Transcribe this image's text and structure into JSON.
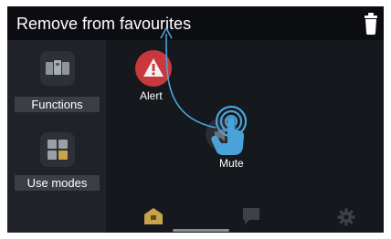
{
  "header": {
    "title": "Remove from favourites",
    "trash_icon": "trash-icon"
  },
  "sidebar": {
    "items": [
      {
        "label": "Functions",
        "icon": "functions-icon"
      },
      {
        "label": "Use modes",
        "icon": "use-modes-icon"
      }
    ]
  },
  "favourites": [
    {
      "label": "Alert",
      "icon": "alert-icon",
      "color": "#c9383d"
    },
    {
      "label": "Mute",
      "icon": "mute-icon"
    }
  ],
  "gesture": {
    "type": "drag-up",
    "icon": "hand-tap-icon"
  },
  "bottom_nav": {
    "items": [
      {
        "icon": "home-icon",
        "active": true,
        "color": "#c9a24a"
      },
      {
        "icon": "chat-icon",
        "active": false
      },
      {
        "icon": "settings-icon",
        "active": false
      }
    ]
  },
  "colors": {
    "accent": "#c9a24a",
    "gesture": "#4aa3d8",
    "background": "#15181d"
  }
}
